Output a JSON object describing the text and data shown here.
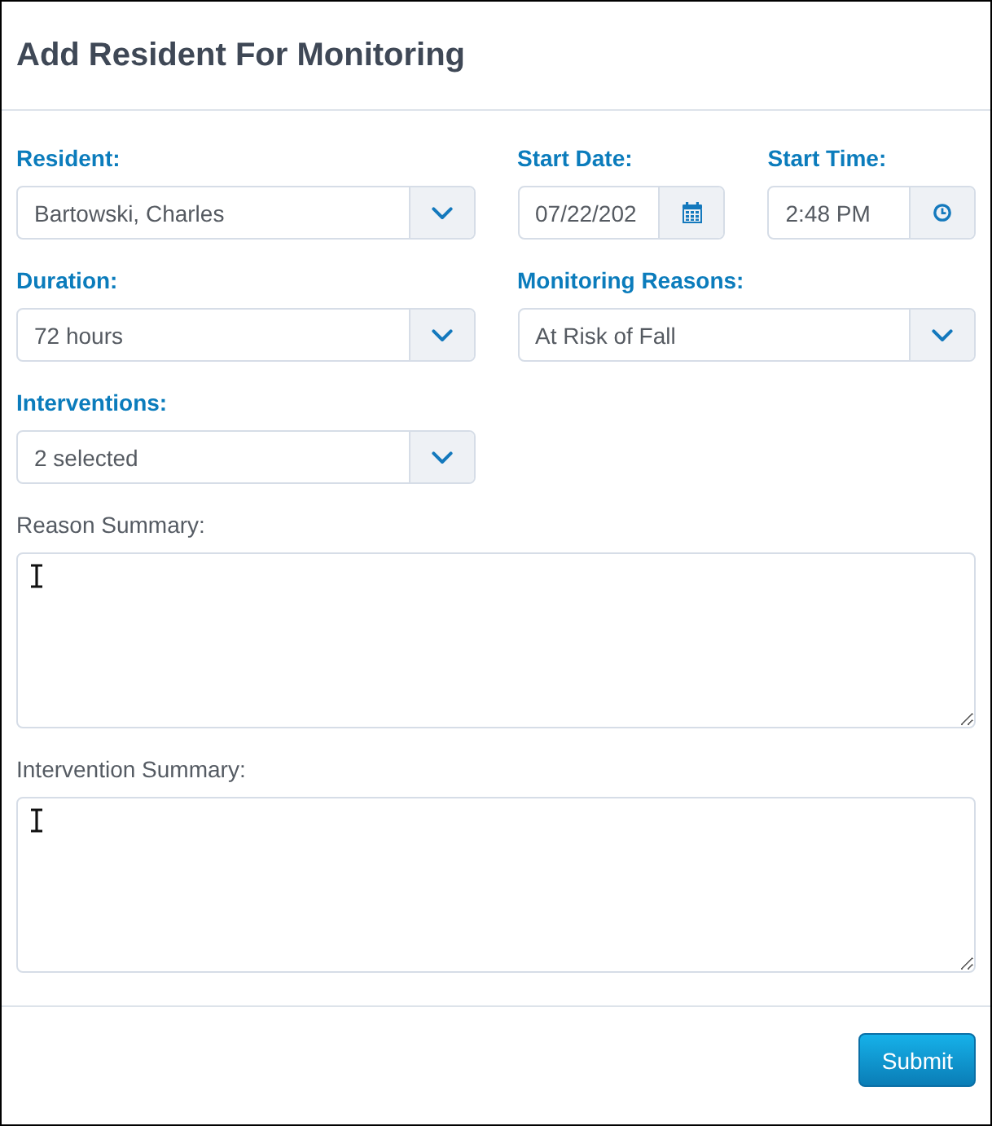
{
  "title": "Add Resident For Monitoring",
  "rows": [
    [
      {
        "kind": "select",
        "label": "Resident:",
        "value": "Bartowski, Charles"
      },
      {
        "kind": "date",
        "label": "Start Date:",
        "value": "07/22/202"
      },
      {
        "kind": "time",
        "label": "Start Time:",
        "value": "2:48 PM"
      }
    ],
    [
      {
        "kind": "select",
        "label": "Duration:",
        "value": "72 hours"
      },
      {
        "kind": "select",
        "label": "Monitoring Reasons:",
        "value": "At Risk of Fall"
      }
    ],
    [
      {
        "kind": "select",
        "label": "Interventions:",
        "value": "2 selected"
      }
    ],
    [
      {
        "kind": "textarea",
        "label": "Reason Summary:"
      }
    ],
    [
      {
        "kind": "textarea",
        "label": "Intervention Summary:"
      }
    ]
  ],
  "submit": {
    "label": "Submit"
  }
}
